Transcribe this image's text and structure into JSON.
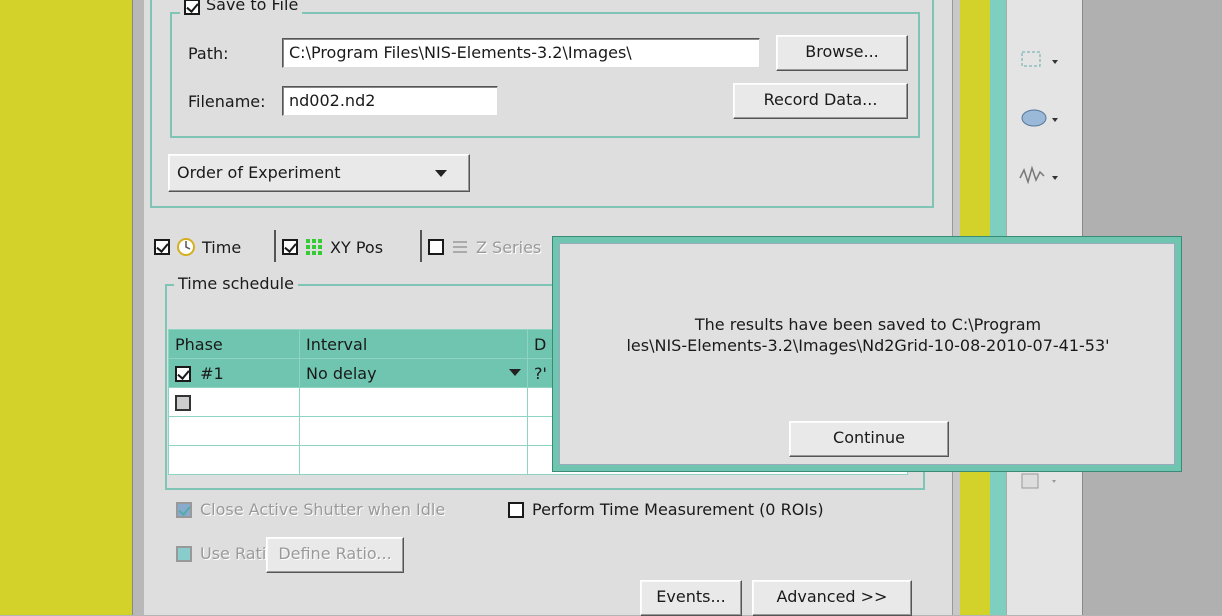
{
  "save_group": {
    "checkbox_label": "Save to File",
    "path_label": "Path:",
    "path_value": "C:\\Program Files\\NIS-Elements-3.2\\Images\\",
    "browse_button": "Browse...",
    "filename_label": "Filename:",
    "filename_value": "nd002.nd2",
    "record_button": "Record Data..."
  },
  "order_dropdown": "Order of Experiment",
  "tabs": [
    {
      "label": "Time",
      "checked": true
    },
    {
      "label": "XY Pos",
      "checked": true
    },
    {
      "label": "Z Series",
      "checked": false
    }
  ],
  "time_schedule": {
    "group_label": "Time schedule",
    "columns": [
      "Phase",
      "Interval",
      "D"
    ],
    "rows": [
      {
        "phase": "#1",
        "interval": "No delay",
        "d": "?'"
      },
      {
        "phase": "",
        "interval": "",
        "d": ""
      },
      {
        "phase": "",
        "interval": "",
        "d": ""
      },
      {
        "phase": "",
        "interval": "",
        "d": ""
      }
    ]
  },
  "options": {
    "close_shutter": "Close Active Shutter when Idle",
    "perform_time": "Perform Time Measurement (0 ROIs)",
    "use_ratio": "Use Ratio",
    "define_ratio": "Define Ratio..."
  },
  "bottom_buttons": {
    "events": "Events...",
    "advanced": "Advanced >>"
  },
  "dialog": {
    "message_line1": "The results have been saved to C:\\Program",
    "message_line2": "les\\NIS-Elements-3.2\\Images\\Nd2Grid-10-08-2010-07-41-53'",
    "continue_button": "Continue"
  },
  "colors": {
    "accent_teal": "#6fc5b0",
    "yellow_bar": "#d2d22a",
    "panel_bg": "#dedede"
  },
  "toolbar_icons": [
    "rectangle-select-icon",
    "ellipse-tool-icon",
    "waveform-tool-icon",
    "tool-icon"
  ]
}
